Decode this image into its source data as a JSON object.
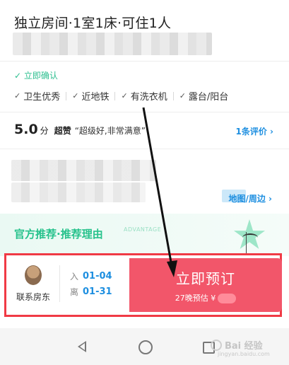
{
  "listing": {
    "title": "独立房间·1室1床·可住1人",
    "instant_confirm": "✓ 立即确认",
    "features": [
      "卫生优秀",
      "近地铁",
      "有洗衣机",
      "露台/阳台"
    ],
    "check_icon": "check-icon"
  },
  "rating": {
    "score": "5.0",
    "unit": "分",
    "label": "超赞",
    "quote": "“超级好,非常满意”",
    "reviews_link": "1条评价 ›"
  },
  "location": {
    "map_link": "地图/周边 ›"
  },
  "promo": {
    "title": "官方推荐·推荐理由",
    "tag": "ADVANTAGE"
  },
  "booking": {
    "contact_label": "联系房东",
    "checkin_label": "入",
    "checkin_date": "01-04",
    "checkout_label": "离",
    "checkout_date": "01-31",
    "book_label": "立即预订",
    "estimate": "27晚预估 ¥"
  },
  "watermark": {
    "brand": "Bai 经验",
    "url": "jingyan.baidu.com"
  },
  "colors": {
    "accent_green": "#2cbf8f",
    "link_blue": "#1e8fe0",
    "book_pink": "#f2566a",
    "highlight_red": "#f03a45"
  }
}
